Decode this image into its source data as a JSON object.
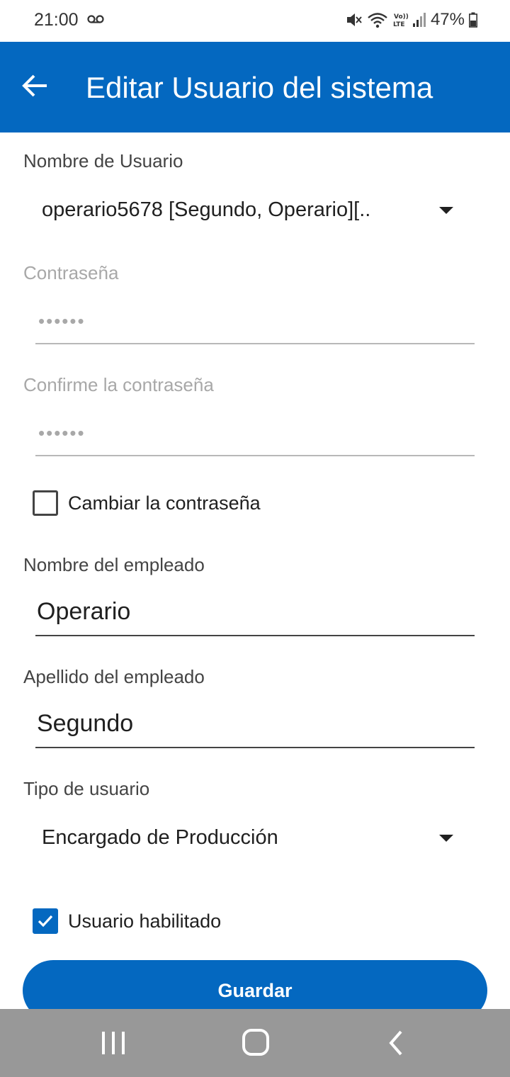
{
  "status_bar": {
    "time": "21:00",
    "battery": "47%"
  },
  "app_bar": {
    "title": "Editar Usuario del sistema"
  },
  "form": {
    "username": {
      "label": "Nombre de Usuario",
      "value": "operario5678 [Segundo, Operario][.."
    },
    "password": {
      "label": "Contraseña",
      "value": "••••••"
    },
    "confirm_password": {
      "label": "Confirme la contraseña",
      "value": "••••••"
    },
    "change_password": {
      "label": "Cambiar la contraseña",
      "checked": false
    },
    "first_name": {
      "label": "Nombre del empleado",
      "value": "Operario"
    },
    "last_name": {
      "label": "Apellido del empleado",
      "value": "Segundo"
    },
    "user_type": {
      "label": "Tipo de usuario",
      "value": "Encargado de Producción"
    },
    "user_enabled": {
      "label": "Usuario habilitado",
      "checked": true
    },
    "save_label": "Guardar"
  },
  "colors": {
    "primary": "#0468c0",
    "nav_bar": "#989898"
  }
}
